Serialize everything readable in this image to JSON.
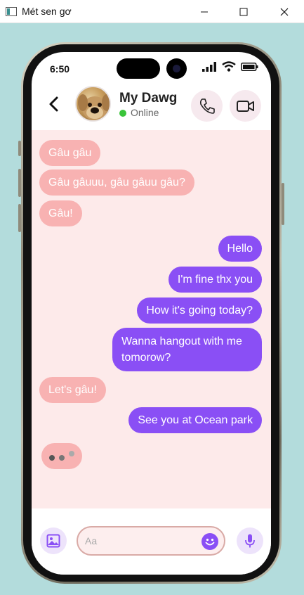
{
  "window": {
    "title": "Mét sen gơ",
    "icons": {
      "app": "app-window-icon",
      "minimize": "minimize-icon",
      "maximize": "maximize-icon",
      "close": "close-icon"
    }
  },
  "status_bar": {
    "time": "6:50"
  },
  "header": {
    "contact_name": "My Dawg",
    "status": "Online",
    "icons": {
      "back": "chevron-left-icon",
      "call": "phone-icon",
      "video": "video-camera-icon"
    }
  },
  "messages": [
    {
      "side": "incoming",
      "text": "Gâu gâu"
    },
    {
      "side": "incoming",
      "text": "Gâu gâuuu, gâu gâuu gâu?"
    },
    {
      "side": "incoming",
      "text": "Gâu!"
    },
    {
      "side": "outgoing",
      "text": "Hello"
    },
    {
      "side": "outgoing",
      "text": "I'm fine thx you"
    },
    {
      "side": "outgoing",
      "text": "How it's going today?"
    },
    {
      "side": "outgoing",
      "text": "Wanna hangout with me tomorow?"
    },
    {
      "side": "incoming",
      "text": "Let's gâu!"
    },
    {
      "side": "outgoing",
      "text": "See you at Ocean park"
    }
  ],
  "typing_indicator": true,
  "composer": {
    "placeholder": "Aa",
    "icons": {
      "image": "image-icon",
      "emoji": "emoji-icon",
      "mic": "microphone-icon"
    }
  },
  "colors": {
    "background": "#b3dcdc",
    "incoming_bubble": "#f8b2b2",
    "outgoing_bubble": "#8a4ff5",
    "chat_background": "#fdeaea",
    "online": "#3ac43a"
  }
}
